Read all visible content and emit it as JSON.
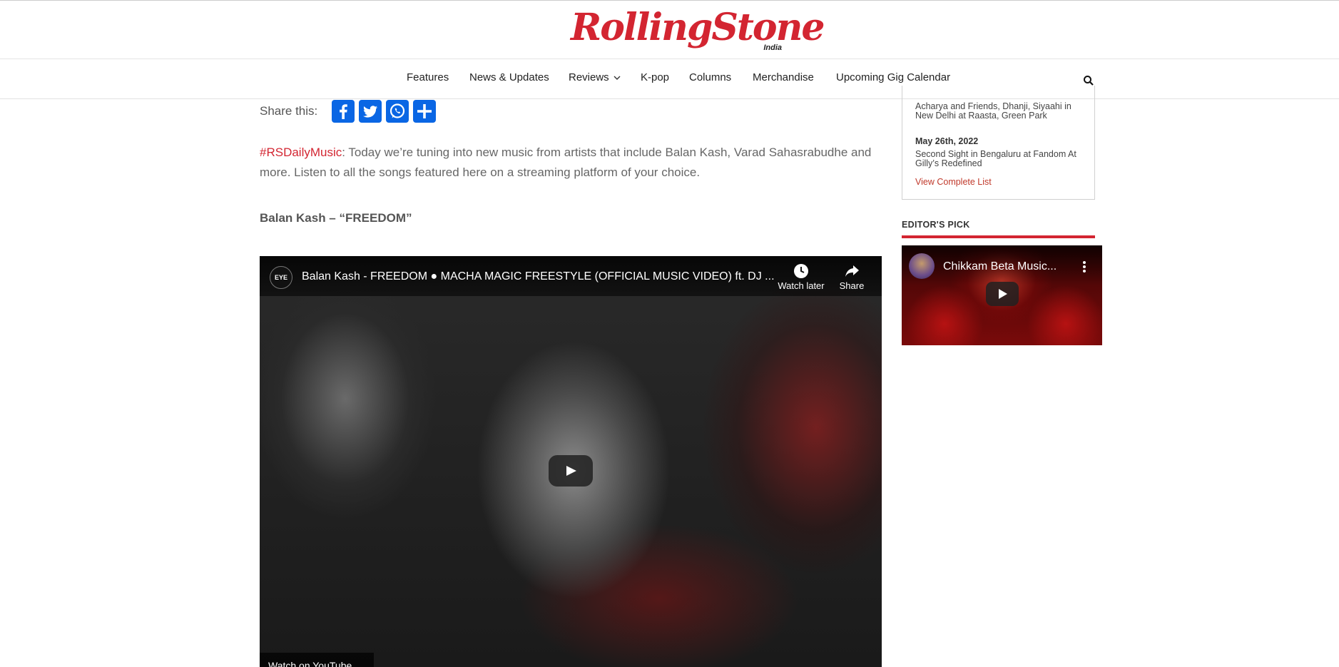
{
  "header": {
    "logo_text": "RollingStone",
    "logo_sub": "India"
  },
  "nav": {
    "items": [
      {
        "label": "Features"
      },
      {
        "label": "News & Updates"
      },
      {
        "label": "Reviews"
      },
      {
        "label": "K-pop"
      },
      {
        "label": "Columns"
      },
      {
        "label": "Merchandise"
      },
      {
        "label": "Upcoming Gig Calendar"
      }
    ],
    "search_icon": "search-icon"
  },
  "share": {
    "label": "Share this:",
    "buttons": [
      {
        "icon": "facebook-icon",
        "color": "#0a66e4"
      },
      {
        "icon": "twitter-icon",
        "color": "#0a66e4"
      },
      {
        "icon": "whatsapp-icon",
        "color": "#0a66e4"
      },
      {
        "icon": "share-icon",
        "color": "#0a66e4"
      }
    ]
  },
  "article": {
    "hashtag": "#RSDailyMusic",
    "intro": ": Today we’re tuning into new music from artists that include Balan Kash, Varad Sahasrabudhe and more. Listen to all the songs featured here on a streaming platform of your choice.",
    "song_title": "Balan Kash – “FREEDOM”"
  },
  "video": {
    "channel_logo": "EYE",
    "title": "Balan Kash - FREEDOM ● MACHA MAGIC FREESTYLE (OFFICIAL MUSIC VIDEO) ft. DJ ...",
    "watch_later": "Watch later",
    "share": "Share",
    "watch_on": "Watch on YouTube"
  },
  "sidebar": {
    "events": [
      {
        "text": "Acharya and Friends, Dhanji, Siyaahi in New Delhi at Raasta, Green Park"
      },
      {
        "date": "May 26th, 2022",
        "text": "Second Sight in Bengaluru at Fandom At Gilly’s Redefined"
      }
    ],
    "view_list": "View Complete List",
    "editors_pick": "EDITOR'S PICK",
    "side_video_title": "Chikkam Beta Music...",
    "accent": "#d32531"
  }
}
